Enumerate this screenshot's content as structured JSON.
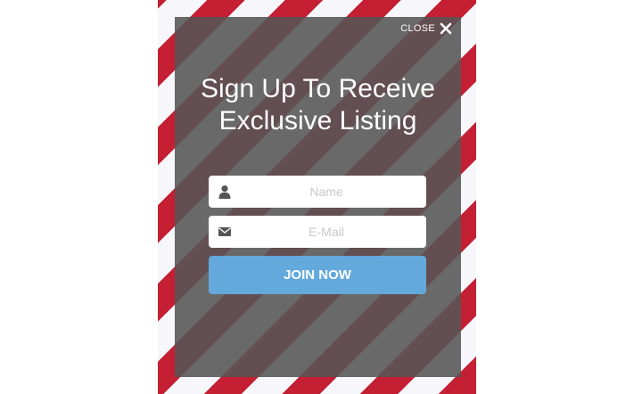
{
  "popup": {
    "close_label": "CLOSE",
    "title_line1": "Sign Up To Receive",
    "title_line2": "Exclusive Listing",
    "name_field": {
      "placeholder": "Name",
      "value": ""
    },
    "email_field": {
      "placeholder": "E-Mail",
      "value": ""
    },
    "submit_label": "JOIN NOW"
  },
  "icons": {
    "close": "close-icon",
    "name": "user-icon",
    "email": "envelope-icon"
  },
  "colors": {
    "stripe_red": "#c41f33",
    "stripe_white": "#f7f7fb",
    "overlay": "#555555",
    "button": "#64a9db",
    "button_text": "#ffffff"
  }
}
